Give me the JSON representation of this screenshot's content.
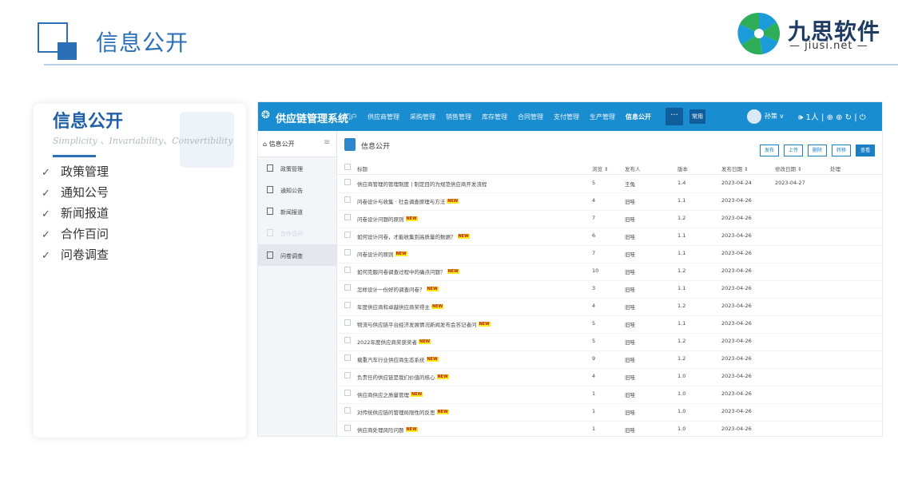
{
  "slide": {
    "title": "信息公开",
    "logo": {
      "name": "九思软件",
      "sub": "— jiusi.net —"
    }
  },
  "card": {
    "title": "信息公开",
    "subtitle": "Simplicity 、Invariability、Convertibility",
    "items": [
      "政策管理",
      "通知公号",
      "新闻报道",
      "合作百问",
      "问卷调查"
    ],
    "check": "✓"
  },
  "app": {
    "name": "供应链管理系统",
    "nav": [
      "门户",
      "供应商管理",
      "采购管理",
      "销售管理",
      "库存管理",
      "合同管理",
      "支付管理",
      "生产管理",
      "信息公开"
    ],
    "nav_active": "信息公开",
    "more": "···",
    "common": "常用",
    "user": "孙策 ∨",
    "top_icons": "🕪 1人 | ⊕ ⊕ ↻ | ⏻",
    "side_title": "信息公开",
    "side_menu_icon": "≡",
    "side_items": [
      {
        "label": "政策管理"
      },
      {
        "label": "通知公告"
      },
      {
        "label": "新闻报道"
      },
      {
        "label": "合作百问"
      },
      {
        "label": "问卷调查"
      }
    ],
    "crumb": "信息公开",
    "actions": [
      "发布",
      "上传",
      "删除",
      "转移",
      "查看"
    ],
    "columns": {
      "title": "标题",
      "views": "浏览 ⇕",
      "publisher": "发布人",
      "version": "版本",
      "pub_date": "发布日期 ⇕",
      "mod_date": "修改日期 ⇕",
      "handle": "处理"
    },
    "new_badge": "NEW",
    "rows": [
      {
        "title": "供应商管理的管理制度 | 制定目的为规范供应商开发流程",
        "new": false,
        "views": "5",
        "publisher": "王兔",
        "version": "1.4",
        "pub_date": "2023-04-24",
        "mod_date": "2023-04-27"
      },
      {
        "title": "问卷设计与收集 · 社会调查原理与方法",
        "new": true,
        "views": "4",
        "publisher": "旧哇",
        "version": "1.1",
        "pub_date": "2023-04-26",
        "mod_date": ""
      },
      {
        "title": "问卷设计问题的原则",
        "new": true,
        "views": "7",
        "publisher": "旧哇",
        "version": "1.2",
        "pub_date": "2023-04-26",
        "mod_date": ""
      },
      {
        "title": "如何设计问卷，才能收集到高质量的数据？",
        "new": true,
        "views": "6",
        "publisher": "旧哇",
        "version": "1.1",
        "pub_date": "2023-04-26",
        "mod_date": ""
      },
      {
        "title": "问卷设计的原则",
        "new": true,
        "views": "7",
        "publisher": "旧哇",
        "version": "1.1",
        "pub_date": "2023-04-26",
        "mod_date": ""
      },
      {
        "title": "如何克服问卷调查过程中的痛点问题？",
        "new": true,
        "views": "10",
        "publisher": "旧哇",
        "version": "1.2",
        "pub_date": "2023-04-26",
        "mod_date": ""
      },
      {
        "title": "怎样设计一份好的调查问卷？",
        "new": true,
        "views": "3",
        "publisher": "旧哇",
        "version": "1.1",
        "pub_date": "2023-04-26",
        "mod_date": ""
      },
      {
        "title": "年度供应商和卓越供应商奖得主",
        "new": true,
        "views": "4",
        "publisher": "旧哇",
        "version": "1.2",
        "pub_date": "2023-04-26",
        "mod_date": ""
      },
      {
        "title": "物流与供应链平台经济发展情况新闻发布会答记者问",
        "new": true,
        "views": "5",
        "publisher": "旧哇",
        "version": "1.1",
        "pub_date": "2023-04-26",
        "mod_date": ""
      },
      {
        "title": "2022年度供应商奖获奖者",
        "new": true,
        "views": "5",
        "publisher": "旧哇",
        "version": "1.2",
        "pub_date": "2023-04-26",
        "mod_date": ""
      },
      {
        "title": "载重汽车行业供应商生态系统",
        "new": true,
        "views": "9",
        "publisher": "旧哇",
        "version": "1.2",
        "pub_date": "2023-04-26",
        "mod_date": ""
      },
      {
        "title": "负责任的供应链是我们价值的核心",
        "new": true,
        "views": "4",
        "publisher": "旧哇",
        "version": "1.0",
        "pub_date": "2023-04-26",
        "mod_date": ""
      },
      {
        "title": "供应商供应之质量管理",
        "new": true,
        "views": "1",
        "publisher": "旧哇",
        "version": "1.0",
        "pub_date": "2023-04-26",
        "mod_date": ""
      },
      {
        "title": "对传统供应链的管理局限性的反思",
        "new": true,
        "views": "1",
        "publisher": "旧哇",
        "version": "1.0",
        "pub_date": "2023-04-26",
        "mod_date": ""
      },
      {
        "title": "供应商处理风险问题",
        "new": true,
        "views": "1",
        "publisher": "旧哇",
        "version": "1.0",
        "pub_date": "2023-04-26",
        "mod_date": ""
      }
    ]
  },
  "colors": {
    "accent": "#2b6fb6",
    "topbar": "#1a8dd0",
    "badge": "#f7e81a"
  }
}
